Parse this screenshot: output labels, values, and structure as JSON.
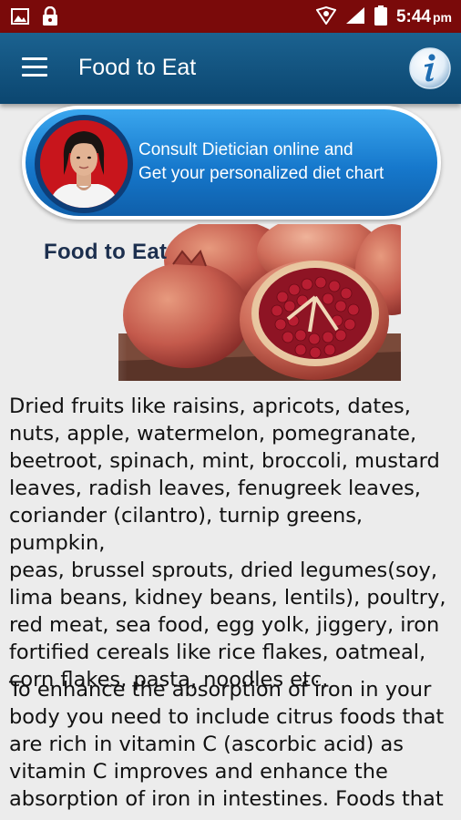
{
  "status_bar": {
    "time": "5:44",
    "period": "pm",
    "left_icons": [
      "image-icon",
      "lock-icon"
    ],
    "right_icons": [
      "vpn-key-icon",
      "signal-icon",
      "battery-icon"
    ]
  },
  "app_bar": {
    "title": "Food to Eat",
    "menu_icon": "hamburger-menu-icon",
    "info_icon": "info-icon"
  },
  "consult_banner": {
    "line1": "Consult Dietician online and",
    "line2": "Get your personalized diet chart"
  },
  "food_image": {
    "heading": "Food to Eat"
  },
  "content": {
    "paragraph1": "Dried fruits like raisins, apricots, dates,\nnuts, apple, watermelon, pomegranate,\nbeetroot, spinach, mint, broccoli, mustard\nleaves, radish leaves, fenugreek leaves,\ncoriander (cilantro), turnip greens, pumpkin,\npeas, brussel sprouts, dried legumes(soy,\nlima beans, kidney beans, lentils), poultry,\nred meat, sea food, egg yolk, jiggery, iron\nfortified cereals like rice flakes, oatmeal,\ncorn flakes, pasta, noodles etc.",
    "paragraph2": "To enhance the absorption of iron in your\nbody you need to include citrus foods that\nare rich in vitamin C (ascorbic acid) as\nvitamin C improves and enhance the\nabsorption of iron in intestines. Foods that"
  },
  "colors": {
    "status_bar": "#7a0a0a",
    "app_bar": "#0b4670",
    "banner_blue": "#1678cc",
    "background": "#ececec"
  }
}
